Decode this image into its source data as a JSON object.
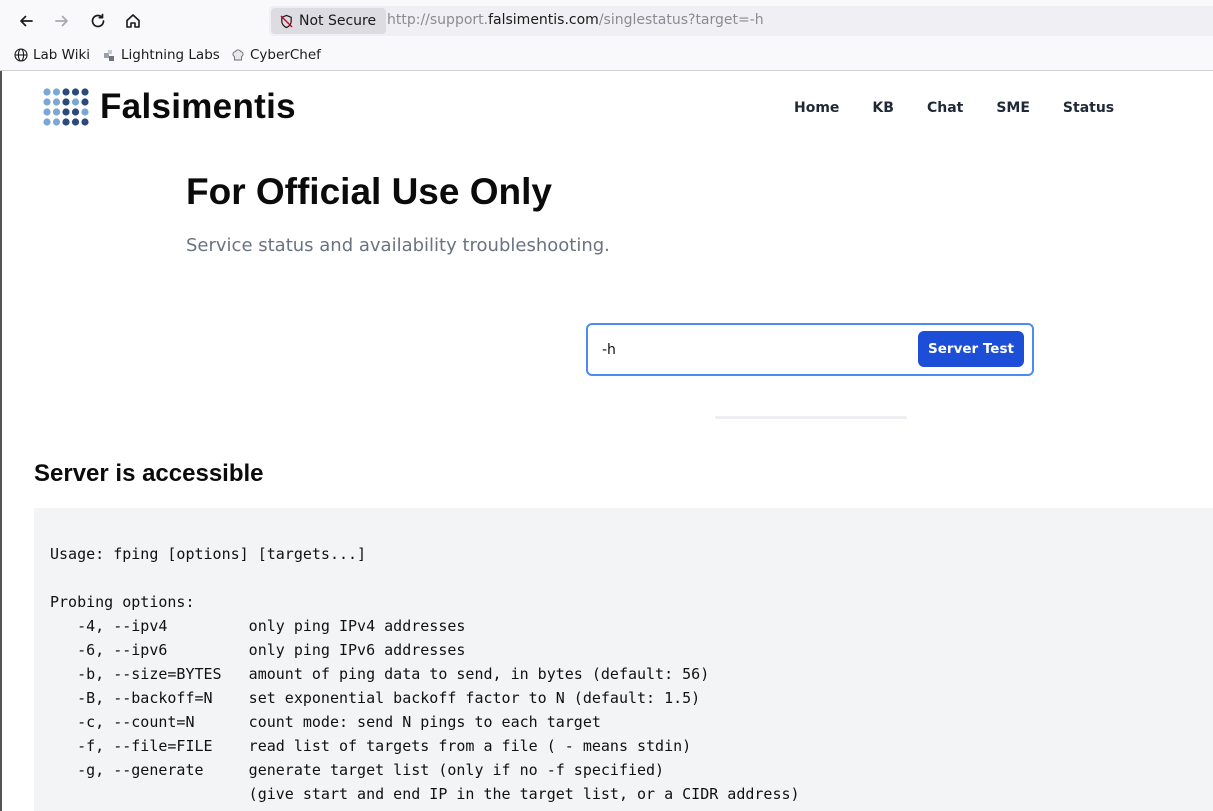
{
  "browser": {
    "security_label": "Not Secure",
    "url_prefix": "http://support.",
    "url_host": "falsimentis.com",
    "url_path": "/singlestatus?target=-h",
    "bookmarks": [
      {
        "label": "Lab Wiki",
        "icon": "globe-icon"
      },
      {
        "label": "Lightning Labs",
        "icon": "lightning-labs-icon"
      },
      {
        "label": "CyberChef",
        "icon": "chef-hat-icon"
      }
    ]
  },
  "site": {
    "brand": "Falsimentis",
    "nav": [
      "Home",
      "KB",
      "Chat",
      "SME",
      "Status"
    ]
  },
  "hero": {
    "title": "For Official Use Only",
    "subtitle": "Service status and availability troubleshooting."
  },
  "search": {
    "value": "-h",
    "button_label": "Server Test"
  },
  "result": {
    "title": "Server is accessible",
    "output": "Usage: fping [options] [targets...]\n\nProbing options:\n   -4, --ipv4         only ping IPv4 addresses\n   -6, --ipv6         only ping IPv6 addresses\n   -b, --size=BYTES   amount of ping data to send, in bytes (default: 56)\n   -B, --backoff=N    set exponential backoff factor to N (default: 1.5)\n   -c, --count=N      count mode: send N pings to each target\n   -f, --file=FILE    read list of targets from a file ( - means stdin)\n   -g, --generate     generate target list (only if no -f specified)\n                      (give start and end IP in the target list, or a CIDR address)"
  },
  "colors": {
    "accent": "#1d4ed8",
    "focus_border": "#4c8bf5",
    "output_bg": "#f3f4f6",
    "logo_dark": "#2b4a7a",
    "logo_light": "#7aa7d6"
  }
}
